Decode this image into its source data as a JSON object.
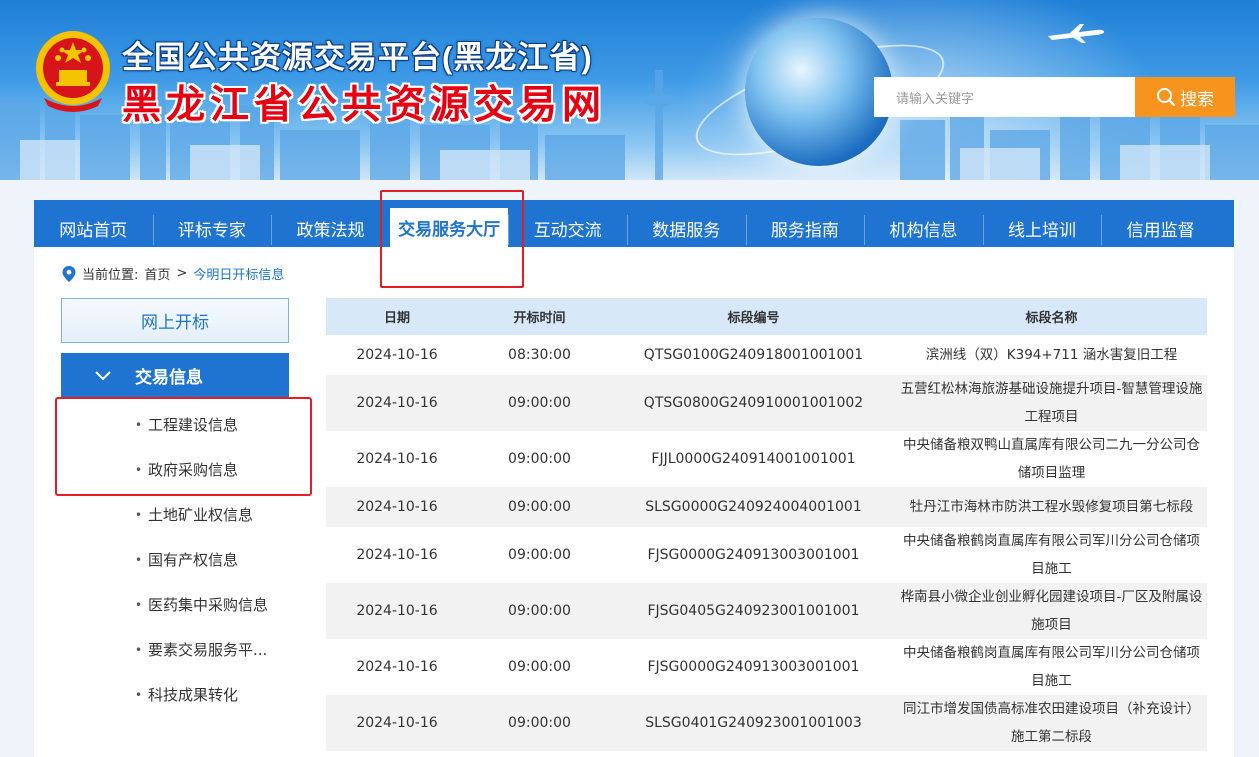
{
  "header": {
    "title_line1": "全国公共资源交易平台(黑龙江省)",
    "title_line2": "黑龙江省公共资源交易网",
    "search_placeholder": "请输入关键字",
    "search_button": "搜索"
  },
  "nav": {
    "items": [
      "网站首页",
      "评标专家",
      "政策法规",
      "交易服务大厅",
      "互动交流",
      "数据服务",
      "服务指南",
      "机构信息",
      "线上培训",
      "信用监督"
    ],
    "active_index": 3
  },
  "breadcrumb": {
    "prefix": "当前位置:",
    "home": "首页",
    "separator": ">",
    "current": "今明日开标信息"
  },
  "sidebar": {
    "online_button": "网上开标",
    "section_title": "交易信息",
    "items": [
      "工程建设信息",
      "政府采购信息",
      "土地矿业权信息",
      "国有产权信息",
      "医药集中采购信息",
      "要素交易服务平...",
      "科技成果转化"
    ]
  },
  "table": {
    "headers": [
      "日期",
      "开标时间",
      "标段编号",
      "标段名称"
    ],
    "rows": [
      {
        "date": "2024-10-16",
        "time": "08:30:00",
        "code": "QTSG0100G240918001001001",
        "name": "滨洲线（双）K394+711 涵水害复旧工程"
      },
      {
        "date": "2024-10-16",
        "time": "09:00:00",
        "code": "QTSG0800G240910001001002",
        "name": "五营红松林海旅游基础设施提升项目-智慧管理设施工程项目"
      },
      {
        "date": "2024-10-16",
        "time": "09:00:00",
        "code": "FJJL0000G240914001001001",
        "name": "中央储备粮双鸭山直属库有限公司二九一分公司仓储项目监理"
      },
      {
        "date": "2024-10-16",
        "time": "09:00:00",
        "code": "SLSG0000G240924004001001",
        "name": "牡丹江市海林市防洪工程水毁修复项目第七标段"
      },
      {
        "date": "2024-10-16",
        "time": "09:00:00",
        "code": "FJSG0000G240913003001001",
        "name": "中央储备粮鹤岗直属库有限公司军川分公司仓储项目施工"
      },
      {
        "date": "2024-10-16",
        "time": "09:00:00",
        "code": "FJSG0405G240923001001001",
        "name": "桦南县小微企业创业孵化园建设项目-厂区及附属设施项目"
      },
      {
        "date": "2024-10-16",
        "time": "09:00:00",
        "code": "FJSG0000G240913003001001",
        "name": "中央储备粮鹤岗直属库有限公司军川分公司仓储项目施工"
      },
      {
        "date": "2024-10-16",
        "time": "09:00:00",
        "code": "SLSG0401G240923001001003",
        "name": "同江市增发国债高标准农田建设项目（补充设计）施工第二标段"
      }
    ]
  },
  "colors": {
    "primary_blue": "#1e74d0",
    "search_orange": "#f7941d",
    "highlight_red": "#e51c23"
  }
}
